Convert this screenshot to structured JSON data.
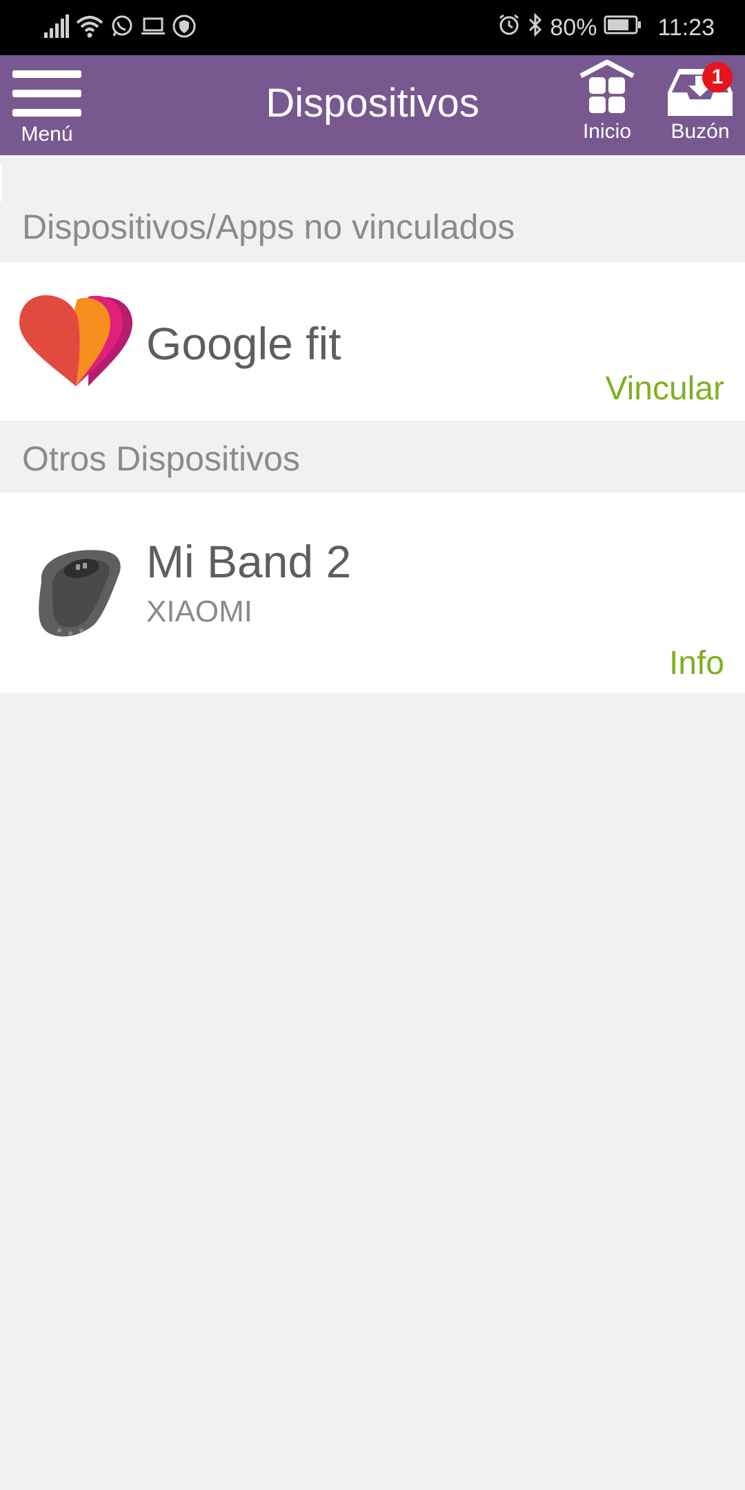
{
  "status_bar": {
    "battery": "80%",
    "time": "11:23",
    "icons": [
      "signal-icon",
      "wifi-icon",
      "whatsapp-icon",
      "laptop-icon",
      "shield-icon",
      "alarm-icon",
      "bluetooth-icon",
      "battery-icon"
    ]
  },
  "app_bar": {
    "menu_label": "Menú",
    "title": "Dispositivos",
    "home_label": "Inicio",
    "inbox_label": "Buzón",
    "inbox_badge": "1",
    "color": "#77598f"
  },
  "unlinked_section": {
    "header": "Dispositivos/Apps no vinculados",
    "items": [
      {
        "name": "Google fit",
        "action": "Vincular",
        "icon": "google-fit-heart-icon"
      }
    ]
  },
  "other_section": {
    "header": "Otros Dispositivos",
    "items": [
      {
        "name": "Mi Band 2",
        "brand": "XIAOMI",
        "action": "Info",
        "icon": "fitness-band-icon"
      }
    ]
  },
  "colors": {
    "accent_green": "#7db021",
    "background": "#f1f1f1"
  }
}
